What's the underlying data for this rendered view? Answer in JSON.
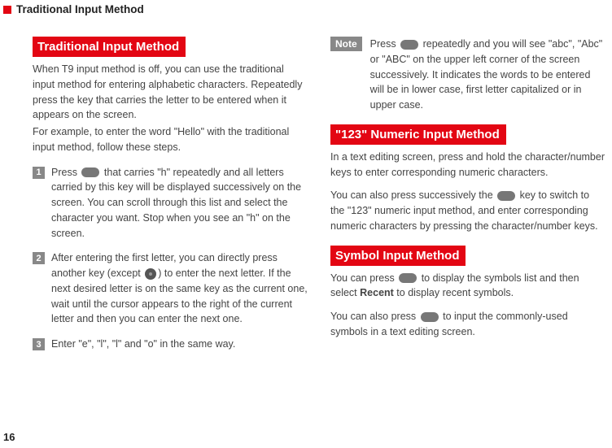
{
  "header": {
    "title": "Traditional Input Method"
  },
  "left": {
    "section_title": "Traditional Input Method",
    "intro1": "When T9 input method is off, you can use the traditional input method for entering alphabetic characters. Repeatedly press the key that carries the letter to be entered when it appears on the screen.",
    "intro2": "For example, to enter the word \"Hello\" with the traditional input method, follow these steps.",
    "steps": [
      {
        "num": "1",
        "pre": "Press ",
        "post": " that carries \"h\" repeatedly and all letters carried by this key will be displayed successively on the screen. You can scroll through this list and select the character you want. Stop when you see an \"h\" on the screen.",
        "icon": "key"
      },
      {
        "num": "2",
        "pre": "After entering the first letter, you can directly press another key (except ",
        "post": ") to enter the next letter. If the next desired letter is on the same key as the current one, wait until the cursor appears to the right of the current letter and then you can enter the next one.",
        "icon": "dpad"
      },
      {
        "num": "3",
        "pre": "Enter \"e\", \"l\", \"l\" and \"o\" in the same way.",
        "post": "",
        "icon": "none"
      }
    ]
  },
  "right": {
    "note": {
      "label": "Note",
      "pre": "Press ",
      "post": " repeatedly and you will see \"abc\", \"Abc\" or \"ABC\" on the upper left corner of the screen successively. It indicates the words to be entered will be in lower case, first letter capitalized or in upper case."
    },
    "numeric": {
      "title": "\"123\" Numeric Input Method",
      "p1": "In a text editing screen, press and hold the character/number keys to enter corresponding numeric characters.",
      "p2_pre": "You can also press successively the ",
      "p2_post": " key to switch to the \"123\" numeric input method, and enter corresponding numeric characters by pressing the character/number keys."
    },
    "symbol": {
      "title": "Symbol Input Method",
      "p1_pre": "You can press ",
      "p1_mid": " to display the symbols list and then select ",
      "p1_bold": "Recent",
      "p1_post": " to display recent symbols.",
      "p2_pre": "You can also press ",
      "p2_post": " to input the commonly-used symbols in a text editing screen."
    }
  },
  "page_number": "16"
}
